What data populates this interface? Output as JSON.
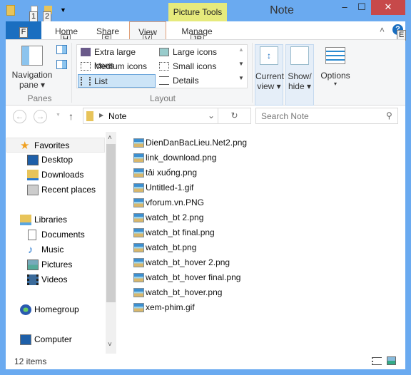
{
  "window": {
    "title": "Note",
    "context_tab": "Picture Tools",
    "minimize": "–",
    "maximize": "☐",
    "close": "✕"
  },
  "keytips": {
    "qat1": "1",
    "qat2": "2",
    "file": "F",
    "home": "H",
    "share": "S",
    "view": "V",
    "manage": "JP",
    "help": "E"
  },
  "tabs": [
    {
      "label": "File"
    },
    {
      "label": "Home"
    },
    {
      "label": "Share"
    },
    {
      "label": "View"
    },
    {
      "label": "Manage"
    }
  ],
  "ribbon": {
    "panes": {
      "nav_pane": "Navigation",
      "nav_pane2": "pane ▾",
      "group": "Panes"
    },
    "layout": {
      "items": [
        "Extra large icons",
        "Large icons",
        "Medium icons",
        "Small icons",
        "List",
        "Details"
      ],
      "selected": "List",
      "group": "Layout"
    },
    "current_view": {
      "l1": "Current",
      "l2": "view ▾"
    },
    "show_hide": {
      "l1": "Show/",
      "l2": "hide ▾"
    },
    "options": {
      "l1": "Options",
      "l2": "▾"
    }
  },
  "address": {
    "path": "Note",
    "search_placeholder": "Search Note"
  },
  "nav": {
    "favorites": "Favorites",
    "desktop": "Desktop",
    "downloads": "Downloads",
    "recent": "Recent places",
    "libraries": "Libraries",
    "documents": "Documents",
    "music": "Music",
    "pictures": "Pictures",
    "videos": "Videos",
    "homegroup": "Homegroup",
    "computer": "Computer"
  },
  "files": [
    "DienDanBacLieu.Net2.png",
    "link_download.png",
    "tải xuống.png",
    "Untitled-1.gif",
    "vforum.vn.PNG",
    "watch_bt 2.png",
    "watch_bt final.png",
    "watch_bt.png",
    "watch_bt_hover 2.png",
    "watch_bt_hover final.png",
    "watch_bt_hover.png",
    "xem-phim.gif"
  ],
  "status": {
    "count": "12 items"
  },
  "colors": {
    "accent": "#1a6ec0",
    "frame": "#6aaaf0",
    "context": "#e6ea7c",
    "selected": "#cce4f7"
  }
}
